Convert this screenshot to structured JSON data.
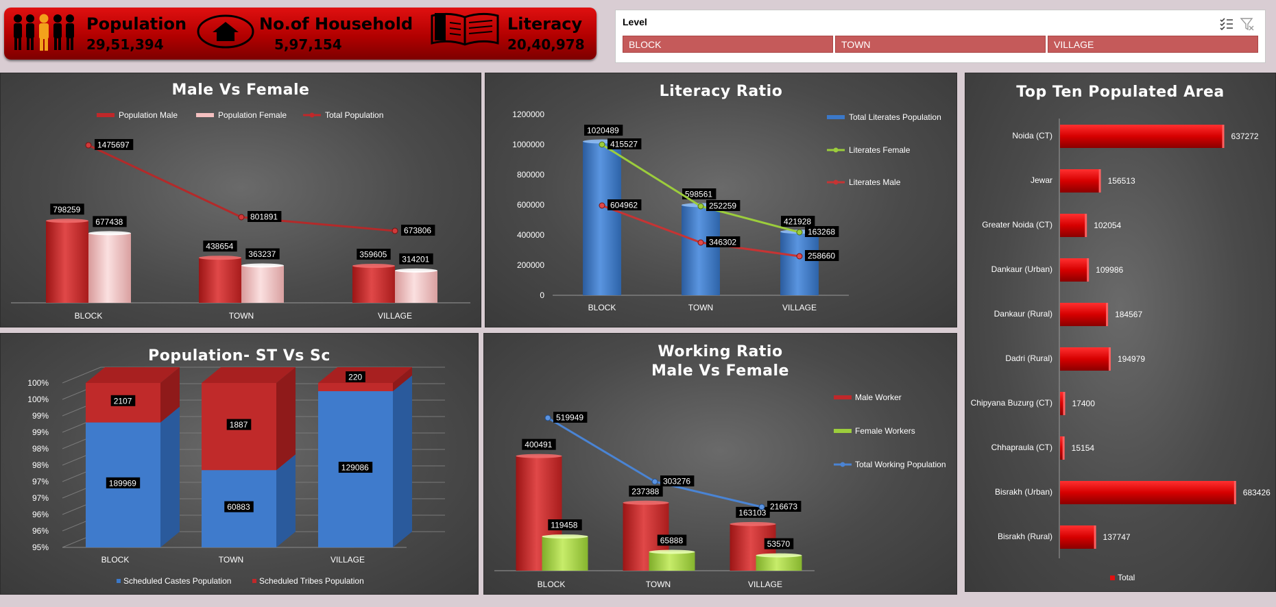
{
  "kpis": [
    {
      "label": "Population",
      "value": "29,51,394",
      "icon": "people-icon"
    },
    {
      "label": "No.of Household",
      "value": "5,97,154",
      "icon": "house-icon"
    },
    {
      "label": "Literacy",
      "value": "20,40,978",
      "icon": "book-icon"
    }
  ],
  "slicer": {
    "title": "Level",
    "items": [
      "BLOCK",
      "TOWN",
      "VILLAGE"
    ],
    "icons": [
      "multi-select-icon",
      "clear-filter-icon"
    ]
  },
  "colors": {
    "red": "#c0282a",
    "pink": "#f2b8b8",
    "blue": "#3b78c8",
    "green": "#9ccd3c",
    "panel": "#4a4a4a"
  },
  "chart_data": [
    {
      "id": "male_female",
      "type": "bar",
      "title": "Male Vs Female",
      "categories": [
        "BLOCK",
        "TOWN",
        "VILLAGE"
      ],
      "series": [
        {
          "name": "Population Male",
          "kind": "bar",
          "values": [
            798259,
            438654,
            359605
          ]
        },
        {
          "name": "Population Female",
          "kind": "bar",
          "values": [
            677438,
            363237,
            314201
          ]
        },
        {
          "name": "Total Population",
          "kind": "line",
          "values": [
            1475697,
            801891,
            673806
          ]
        }
      ],
      "legend": "top"
    },
    {
      "id": "literacy",
      "type": "bar",
      "title": "Literacy Ratio",
      "categories": [
        "BLOCK",
        "TOWN",
        "VILLAGE"
      ],
      "ylim": [
        0,
        1200000
      ],
      "yticks": [
        "0",
        "200000",
        "400000",
        "600000",
        "800000",
        "1000000",
        "1200000"
      ],
      "series": [
        {
          "name": "Total Literates Population",
          "kind": "bar",
          "values": [
            1020489,
            598561,
            421928
          ]
        },
        {
          "name": "Literates Female",
          "kind": "line",
          "values": [
            415527,
            252259,
            163268
          ]
        },
        {
          "name": "Literates Male",
          "kind": "line",
          "values": [
            604962,
            346302,
            258660
          ]
        }
      ],
      "legend": "right"
    },
    {
      "id": "top_ten",
      "type": "bar",
      "title": "Top Ten Populated Area",
      "categories": [
        "Noida (CT)",
        "Jewar",
        "Greater Noida (CT)",
        "Dankaur (Urban)",
        "Dankaur (Rural)",
        "Dadri (Rural)",
        "Chipyana Buzurg (CT)",
        "Chhapraula (CT)",
        "Bisrakh (Urban)",
        "Bisrakh (Rural)"
      ],
      "series": [
        {
          "name": "Total",
          "values": [
            637272,
            156513,
            102054,
            109986,
            184567,
            194979,
            17400,
            15154,
            683426,
            137747
          ]
        }
      ],
      "legend": "bottom"
    },
    {
      "id": "st_sc",
      "type": "bar",
      "title": "Population- ST Vs Sc",
      "categories": [
        "BLOCK",
        "TOWN",
        "VILLAGE"
      ],
      "yticks": [
        "95%",
        "96%",
        "96%",
        "97%",
        "97%",
        "98%",
        "98%",
        "99%",
        "99%",
        "100%",
        "100%"
      ],
      "series": [
        {
          "name": "Scheduled Castes Population",
          "values": [
            189969,
            60883,
            129086
          ]
        },
        {
          "name": "Scheduled Tribes Population",
          "values": [
            2107,
            1887,
            220
          ]
        }
      ],
      "legend": "bottom"
    },
    {
      "id": "working",
      "type": "bar",
      "title": "Working Ratio",
      "subtitle": "Male Vs Female",
      "categories": [
        "BLOCK",
        "TOWN",
        "VILLAGE"
      ],
      "series": [
        {
          "name": "Male Worker",
          "kind": "bar",
          "values": [
            400491,
            237388,
            163103
          ]
        },
        {
          "name": "Female Workers",
          "kind": "bar",
          "values": [
            119458,
            65888,
            53570
          ]
        },
        {
          "name": "Total Working Population",
          "kind": "line",
          "values": [
            519949,
            303276,
            216673
          ]
        }
      ],
      "legend": "right"
    }
  ]
}
